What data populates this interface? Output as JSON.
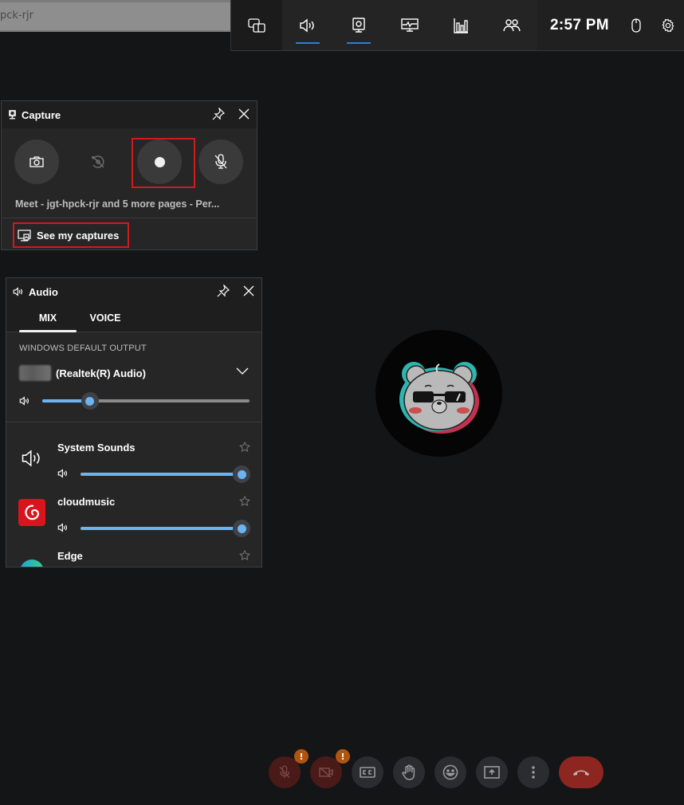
{
  "browser": {
    "url_fragment": "pck-rjr"
  },
  "gamebar": {
    "buttons": [
      {
        "name": "widget-menu",
        "icon": "widget-menu-icon",
        "active": false
      },
      {
        "name": "audio",
        "icon": "speaker-icon",
        "active": true
      },
      {
        "name": "capture",
        "icon": "capture-icon",
        "active": true
      },
      {
        "name": "performance",
        "icon": "performance-monitor-icon",
        "active": false
      },
      {
        "name": "resources",
        "icon": "bar-chart-icon",
        "active": false
      },
      {
        "name": "xbox-social",
        "icon": "people-icon",
        "active": false
      }
    ],
    "time": "2:57 PM",
    "mouse_icon": "mouse-icon",
    "settings_icon": "gear-icon",
    "accent_color": "#2f7dd1"
  },
  "capture": {
    "title": "Capture",
    "buttons": [
      {
        "name": "screenshot",
        "icon": "camera-icon"
      },
      {
        "name": "record-last-30s",
        "icon": "record-that-disabled-icon"
      },
      {
        "name": "start-recording",
        "icon": "record-dot-icon",
        "highlighted": true
      },
      {
        "name": "mic-while-recording",
        "icon": "mic-off-icon"
      }
    ],
    "source_label": "Meet - jgt-hpck-rjr and 5 more pages - Per...",
    "see_captures_label": "See my captures",
    "highlight_color": "#d11b1b"
  },
  "audio": {
    "title": "Audio",
    "tabs": [
      {
        "label": "MIX",
        "selected": true
      },
      {
        "label": "VOICE",
        "selected": false
      }
    ],
    "section_label": "WINDOWS DEFAULT OUTPUT",
    "device_name": "(Realtek(R) Audio)",
    "master_volume_fraction": 0.23,
    "apps": [
      {
        "name": "System Sounds",
        "icon": "speaker-icon",
        "volume_fraction": 1.0
      },
      {
        "name": "cloudmusic",
        "icon": "netease-cloudmusic-icon",
        "volume_fraction": 1.0
      },
      {
        "name": "Edge",
        "icon": "edge-icon",
        "volume_fraction": null
      }
    ],
    "slider_color": "#6cb4f0"
  },
  "meet": {
    "controls": [
      {
        "name": "microphone",
        "icon": "mic-off-icon",
        "warning": "!"
      },
      {
        "name": "camera",
        "icon": "camera-off-icon",
        "warning": "!"
      },
      {
        "name": "captions",
        "icon": "captions-icon"
      },
      {
        "name": "raise-hand",
        "icon": "hand-icon"
      },
      {
        "name": "reactions",
        "icon": "emoji-icon"
      },
      {
        "name": "present",
        "icon": "present-screen-icon"
      },
      {
        "name": "more-options",
        "icon": "more-vert-icon"
      },
      {
        "name": "leave-call",
        "icon": "hang-up-icon"
      }
    ],
    "end_call_color": "#8d2620"
  }
}
